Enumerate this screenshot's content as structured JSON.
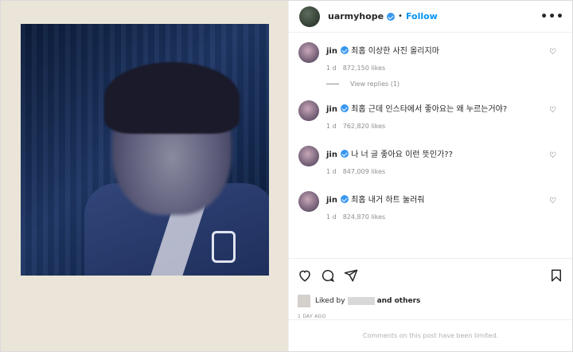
{
  "post": {
    "username": "uarmyhope",
    "follow_label": "Follow",
    "more_label": "•••",
    "dot": "•"
  },
  "comments": [
    {
      "name": "jin",
      "text": "최홉 이상한 사진 올리지마",
      "age": "1 d",
      "likes": "872,150 likes",
      "view_replies": "View replies (1)"
    },
    {
      "name": "jin",
      "text": "최홉 근데 인스타에서 좋아요는 왜 누르는거야?",
      "age": "1 d",
      "likes": "762,820 likes"
    },
    {
      "name": "jin",
      "text": "나 너 글 좋아요 이런 뜻인가??",
      "age": "1 d",
      "likes": "847,009 likes"
    },
    {
      "name": "jin",
      "text": "최홉 내거 하트 눌러줘",
      "age": "1 d",
      "likes": "824,870 likes"
    }
  ],
  "footer": {
    "liked_by_prefix": "Liked by",
    "and_others": "and others",
    "date": "1 DAY AGO",
    "limited_text": "Comments on this post have been limited."
  },
  "icons": {
    "heart": "heart-icon",
    "comment": "comment-icon",
    "share": "share-icon",
    "save": "bookmark-icon",
    "verified": "verified-badge-icon"
  },
  "colors": {
    "accent": "#0095f6",
    "verified": "#3897f0",
    "muted": "#8e8e8e"
  }
}
